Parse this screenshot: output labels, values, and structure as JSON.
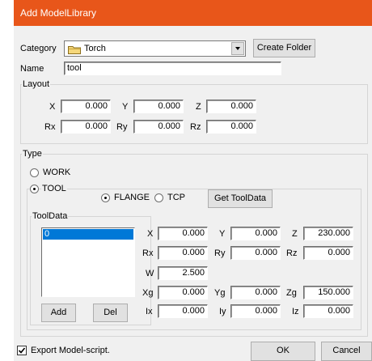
{
  "window": {
    "title": "Add ModelLibrary"
  },
  "category": {
    "label": "Category",
    "value": "Torch",
    "icon": "folder-icon",
    "create_folder_label": "Create Folder"
  },
  "name": {
    "label": "Name",
    "value": "tool"
  },
  "layout": {
    "label": "Layout",
    "x": {
      "label": "X",
      "value": "0.000"
    },
    "y": {
      "label": "Y",
      "value": "0.000"
    },
    "z": {
      "label": "Z",
      "value": "0.000"
    },
    "rx": {
      "label": "Rx",
      "value": "0.000"
    },
    "ry": {
      "label": "Ry",
      "value": "0.000"
    },
    "rz": {
      "label": "Rz",
      "value": "0.000"
    }
  },
  "type": {
    "label": "Type",
    "work_label": "WORK",
    "tool_label": "TOOL",
    "selected": "TOOL",
    "flange_label": "FLANGE",
    "tcp_label": "TCP",
    "tool_mode_selected": "FLANGE",
    "get_tooldata_label": "Get ToolData"
  },
  "tooldata": {
    "label": "ToolData",
    "items": [
      "0"
    ],
    "add_label": "Add",
    "del_label": "Del",
    "x": {
      "label": "X",
      "value": "0.000"
    },
    "y": {
      "label": "Y",
      "value": "0.000"
    },
    "z": {
      "label": "Z",
      "value": "230.000"
    },
    "rx": {
      "label": "Rx",
      "value": "0.000"
    },
    "ry": {
      "label": "Ry",
      "value": "0.000"
    },
    "rz": {
      "label": "Rz",
      "value": "0.000"
    },
    "w": {
      "label": "W",
      "value": "2.500"
    },
    "xg": {
      "label": "Xg",
      "value": "0.000"
    },
    "yg": {
      "label": "Yg",
      "value": "0.000"
    },
    "zg": {
      "label": "Zg",
      "value": "150.000"
    },
    "ix": {
      "label": "Ix",
      "value": "0.000"
    },
    "iy": {
      "label": "Iy",
      "value": "0.000"
    },
    "iz": {
      "label": "Iz",
      "value": "0.000"
    }
  },
  "footer": {
    "export_label": "Export Model-script.",
    "export_checked": true,
    "ok_label": "OK",
    "cancel_label": "Cancel"
  },
  "colors": {
    "titlebar": "#e8561a",
    "selection": "#0078d7",
    "dialog_bg": "#f0f0f0"
  }
}
